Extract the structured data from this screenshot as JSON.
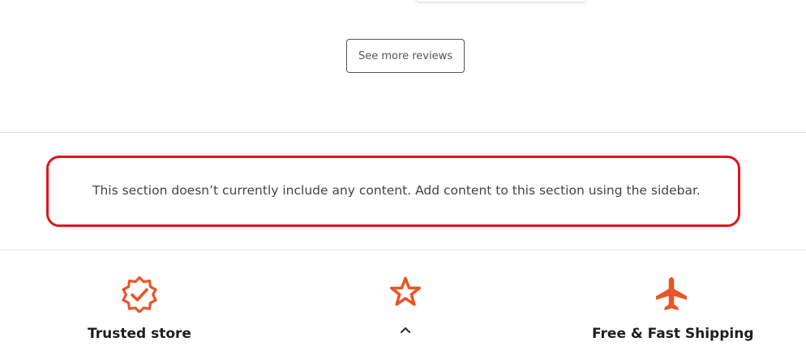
{
  "reviews": {
    "see_more_label": "See more reviews"
  },
  "empty_section": {
    "message": "This section doesn’t currently include any content. Add content to this section using the sidebar.",
    "highlight_color": "#e0141e"
  },
  "features": [
    {
      "icon": "verified-badge-icon",
      "label": "Trusted store"
    },
    {
      "icon": "star-icon",
      "label": ""
    },
    {
      "icon": "airplane-icon",
      "label": "Free & Fast Shipping"
    }
  ],
  "scroll_up": {
    "icon": "chevron-up-icon"
  },
  "colors": {
    "accent": "#e8562a"
  }
}
